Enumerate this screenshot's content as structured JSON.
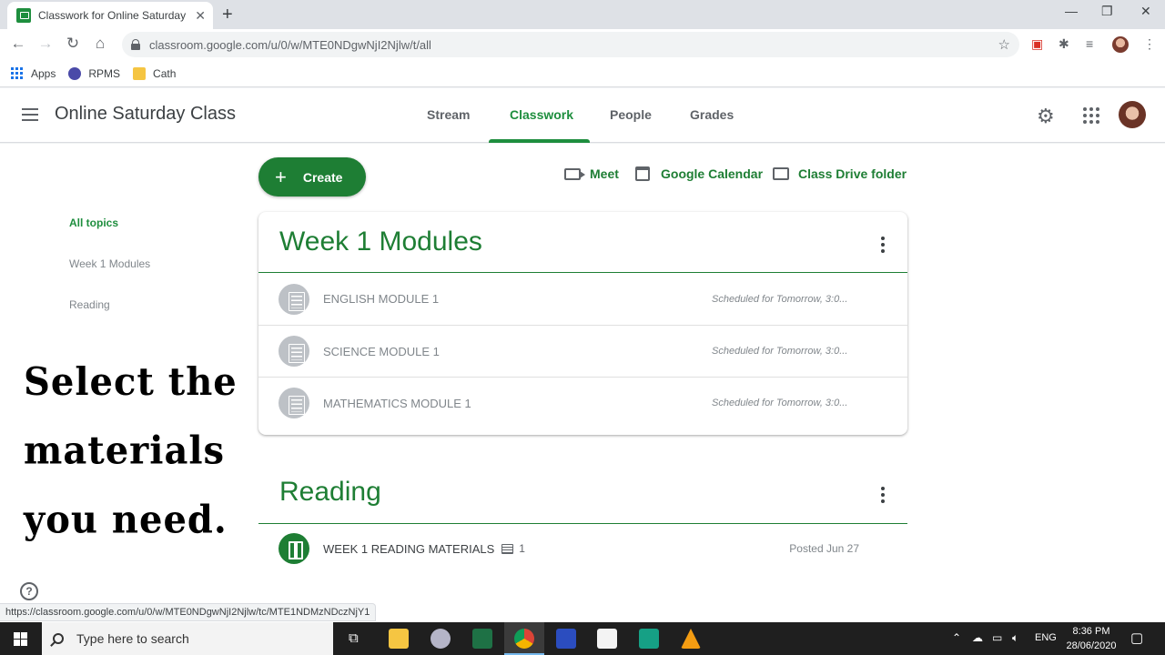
{
  "browser": {
    "tab_title": "Classwork for Online Saturday Cl",
    "url": "classroom.google.com/u/0/w/MTE0NDgwNjI2Njlw/t/all",
    "bookmarks": [
      "Apps",
      "RPMS",
      "Cath"
    ],
    "status_url": "https://classroom.google.com/u/0/w/MTE0NDgwNjI2Njlw/tc/MTE1NDMzNDczNjY1"
  },
  "header": {
    "class_name": "Online Saturday Class",
    "tabs": [
      "Stream",
      "Classwork",
      "People",
      "Grades"
    ],
    "active_tab": "Classwork"
  },
  "toolbar": {
    "create_label": "Create",
    "meet_label": "Meet",
    "calendar_label": "Google Calendar",
    "drive_label": "Class Drive folder"
  },
  "sidebar": {
    "topics": [
      "All topics",
      "Week 1 Modules",
      "Reading"
    ]
  },
  "overlay_text": [
    "Select the",
    "materials",
    "you need."
  ],
  "topics": [
    {
      "title": "Week 1 Modules",
      "items": [
        {
          "name": "ENGLISH MODULE 1",
          "status": "Scheduled for Tomorrow, 3:0..."
        },
        {
          "name": "SCIENCE MODULE 1",
          "status": "Scheduled for Tomorrow, 3:0..."
        },
        {
          "name": "MATHEMATICS MODULE 1",
          "status": "Scheduled for Tomorrow, 3:0..."
        }
      ]
    },
    {
      "title": "Reading",
      "items": [
        {
          "name": "WEEK 1 READING MATERIALS",
          "comments": "1",
          "status": "Posted Jun 27"
        }
      ]
    }
  ],
  "taskbar": {
    "search_placeholder": "Type here to search",
    "language": "ENG",
    "time": "8:36 PM",
    "date": "28/06/2020"
  },
  "colors": {
    "accent": "#1e7e34",
    "muted": "#80868b"
  }
}
